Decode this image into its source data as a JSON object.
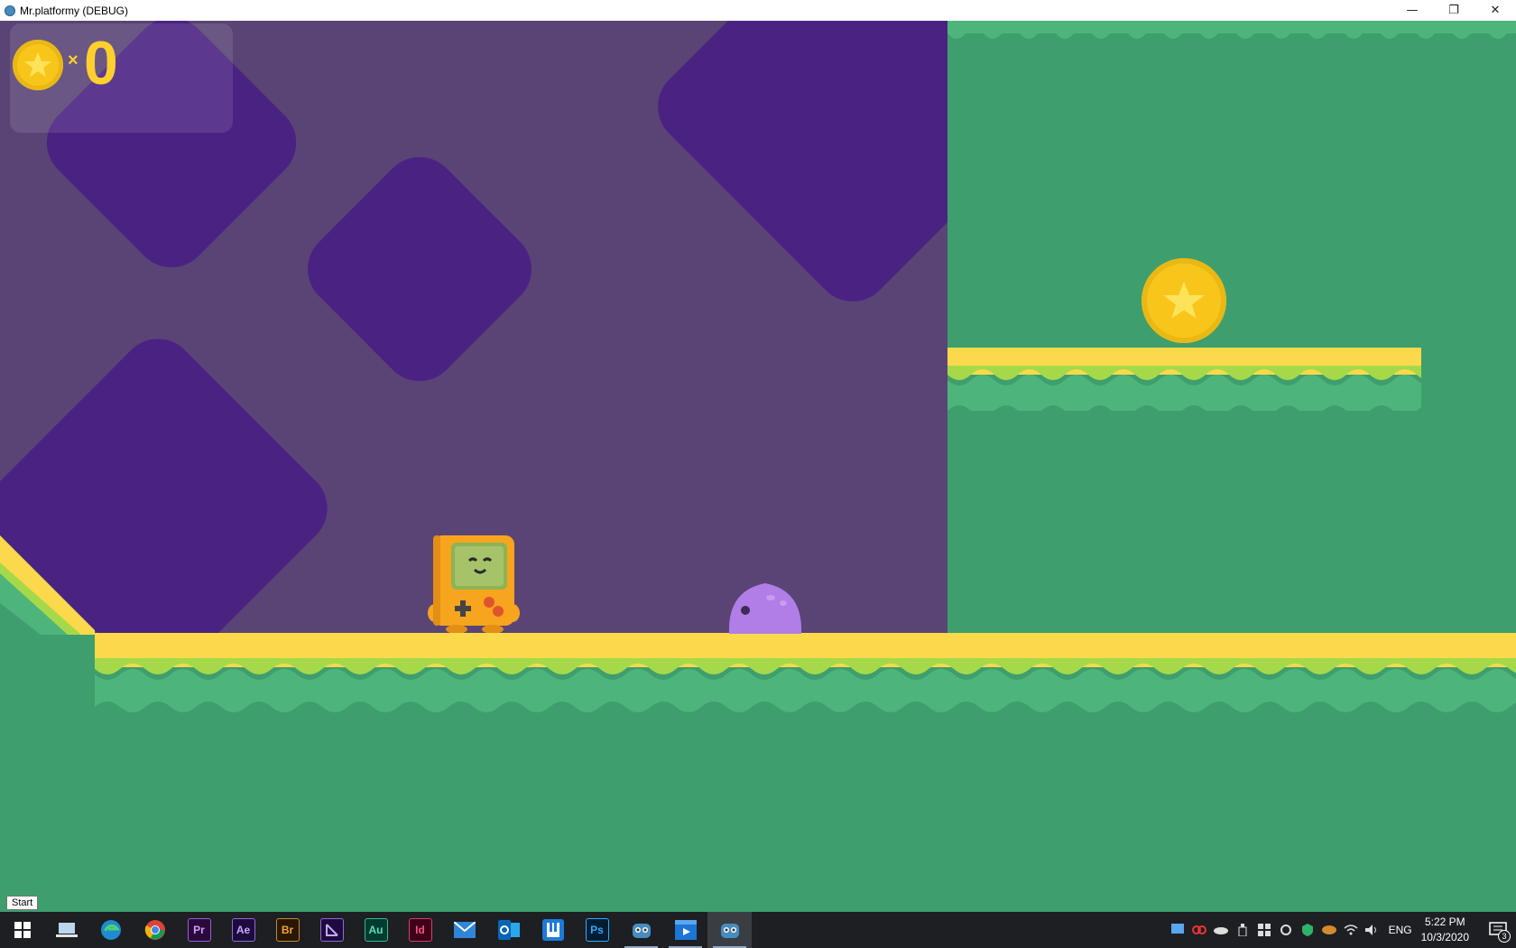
{
  "window": {
    "title": "Mr.platformy (DEBUG)"
  },
  "window_controls": {
    "minimize": "—",
    "restore": "❐",
    "close": "✕"
  },
  "hud": {
    "multiplier": "×",
    "coin_count": "0"
  },
  "tooltip": {
    "start": "Start"
  },
  "taskbar": {
    "apps": [
      {
        "name": "file-manager",
        "label": ""
      },
      {
        "name": "edge",
        "label": ""
      },
      {
        "name": "chrome",
        "label": ""
      },
      {
        "name": "premiere",
        "label": "Pr"
      },
      {
        "name": "after-effects",
        "label": "Ae"
      },
      {
        "name": "bridge",
        "label": "Br"
      },
      {
        "name": "animate",
        "label": ""
      },
      {
        "name": "audition",
        "label": "Au"
      },
      {
        "name": "indesign",
        "label": "Id"
      },
      {
        "name": "mail",
        "label": ""
      },
      {
        "name": "outlook",
        "label": ""
      },
      {
        "name": "app-h",
        "label": ""
      },
      {
        "name": "photoshop",
        "label": "Ps"
      },
      {
        "name": "godot",
        "label": ""
      },
      {
        "name": "media",
        "label": ""
      },
      {
        "name": "godot-game",
        "label": ""
      }
    ],
    "language": "ENG",
    "time": "5:22 PM",
    "date": "10/3/2020",
    "notification_count": "3"
  },
  "colors": {
    "sky": "#5a4476",
    "diamond": "#4a2382",
    "grass": "#3f9e6d",
    "sand": "#fcd94a",
    "coin": "#f8c61b",
    "hud_text": "#ffcf2e",
    "player": "#f7a41f",
    "slime": "#b07ee6"
  }
}
